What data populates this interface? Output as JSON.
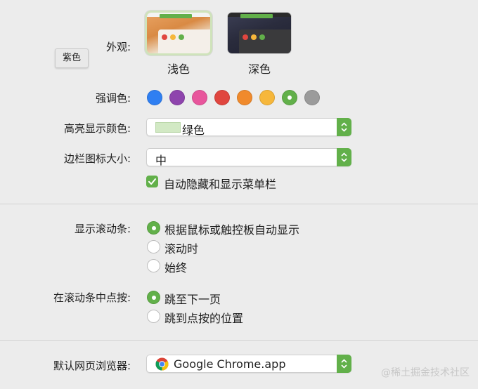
{
  "appearance": {
    "label": "外观:",
    "tooltip": "紫色",
    "light_caption": "浅色",
    "dark_caption": "深色",
    "selected": "浅色"
  },
  "accent": {
    "label": "强调色:",
    "colors": [
      "#2f7ff2",
      "#8e44ad",
      "#e8559c",
      "#e0463f",
      "#f08a2c",
      "#f6b73b",
      "#62b04a",
      "#9b9b9b"
    ],
    "selected": "#62b04a"
  },
  "highlight": {
    "label": "高亮显示颜色:",
    "value": "绿色",
    "swatch_color": "#d2e9c4"
  },
  "sidebar_icon_size": {
    "label": "边栏图标大小:",
    "value": "中"
  },
  "autohide_menubar": {
    "label": "自动隐藏和显示菜单栏",
    "checked": true
  },
  "show_scrollbars": {
    "label": "显示滚动条:",
    "options": [
      "根据鼠标或触控板自动显示",
      "滚动时",
      "始终"
    ],
    "selected": "根据鼠标或触控板自动显示"
  },
  "click_scrollbar": {
    "label": "在滚动条中点按:",
    "options": [
      "跳至下一页",
      "跳到点按的位置"
    ],
    "selected": "跳至下一页"
  },
  "default_browser": {
    "label": "默认网页浏览器:",
    "value": "Google Chrome.app",
    "icon": "chrome-icon"
  },
  "watermark": "@稀土掘金技术社区",
  "colors": {
    "accent": "#62b04a",
    "background": "#ececec"
  }
}
